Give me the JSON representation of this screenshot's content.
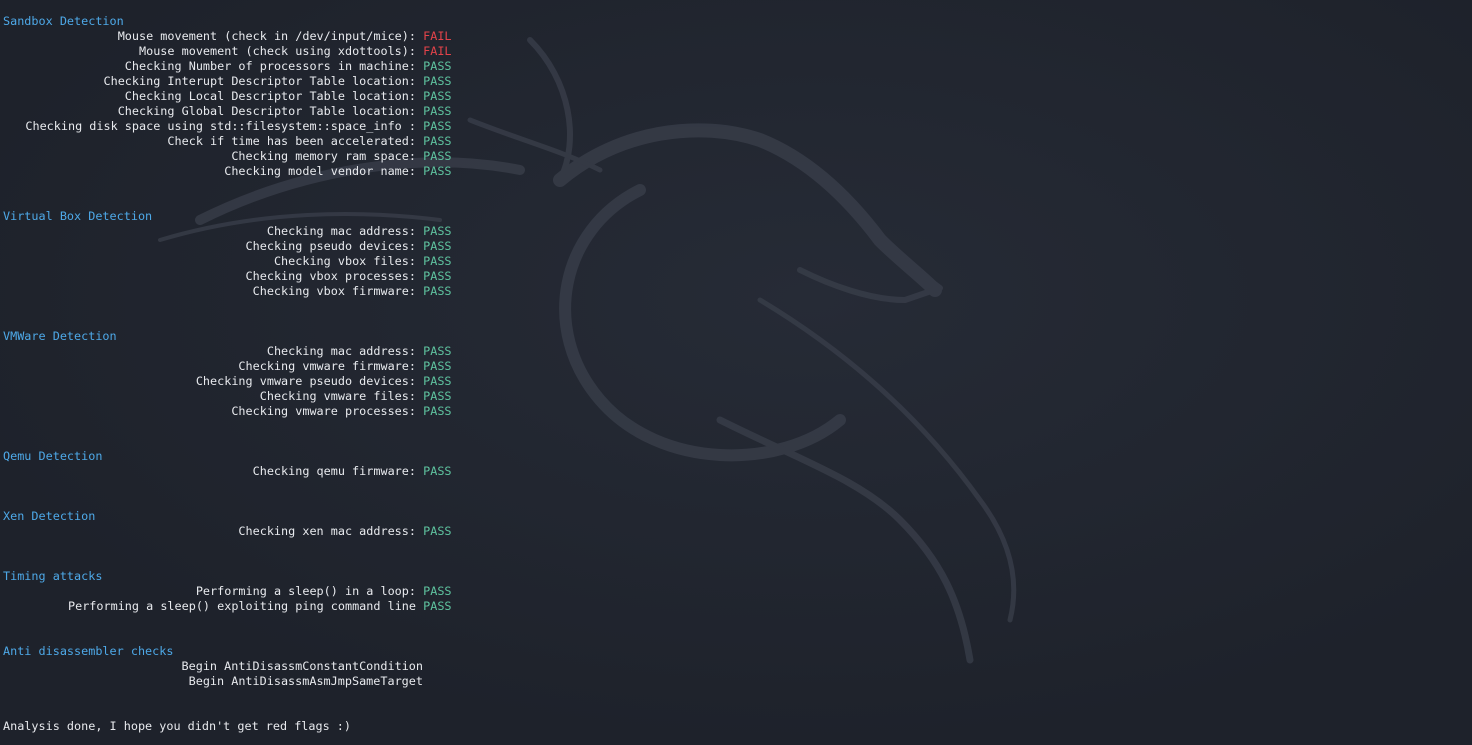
{
  "colors": {
    "background": "#1f232d",
    "header": "#4ea9e8",
    "pass": "#5fc4a0",
    "fail": "#e3434a",
    "text": "#e8eaee"
  },
  "background_icon": "kali-dragon-watermark",
  "sections": [
    {
      "title": "Sandbox Detection",
      "checks": [
        {
          "label": "Mouse movement (check in /dev/input/mice)",
          "sep": ":",
          "status": "FAIL"
        },
        {
          "label": "Mouse movement (check using xdottools)",
          "sep": ":",
          "status": "FAIL"
        },
        {
          "label": "Checking Number of processors in machine",
          "sep": ":",
          "status": "PASS"
        },
        {
          "label": "Checking Interupt Descriptor Table location",
          "sep": ":",
          "status": "PASS"
        },
        {
          "label": "Checking Local Descriptor Table location",
          "sep": ":",
          "status": "PASS"
        },
        {
          "label": "Checking Global Descriptor Table location",
          "sep": ":",
          "status": "PASS"
        },
        {
          "label": "Checking disk space using std::filesystem::space_info ",
          "sep": ":",
          "status": "PASS"
        },
        {
          "label": "Check if time has been accelerated",
          "sep": ":",
          "status": "PASS"
        },
        {
          "label": "Checking memory ram space",
          "sep": ":",
          "status": "PASS"
        },
        {
          "label": "Checking model vendor name",
          "sep": ":",
          "status": "PASS"
        }
      ]
    },
    {
      "title": "Virtual Box Detection",
      "checks": [
        {
          "label": "Checking mac address",
          "sep": ":",
          "status": "PASS"
        },
        {
          "label": "Checking pseudo devices",
          "sep": ":",
          "status": "PASS"
        },
        {
          "label": "Checking vbox files",
          "sep": ":",
          "status": "PASS"
        },
        {
          "label": "Checking vbox processes",
          "sep": ":",
          "status": "PASS"
        },
        {
          "label": "Checking vbox firmware",
          "sep": ":",
          "status": "PASS"
        }
      ]
    },
    {
      "title": "VMWare Detection",
      "checks": [
        {
          "label": "Checking mac address",
          "sep": ":",
          "status": "PASS"
        },
        {
          "label": "Checking vmware firmware",
          "sep": ":",
          "status": "PASS"
        },
        {
          "label": "Checking vmware pseudo devices",
          "sep": ":",
          "status": "PASS"
        },
        {
          "label": "Checking vmware files",
          "sep": ":",
          "status": "PASS"
        },
        {
          "label": "Checking vmware processes",
          "sep": ":",
          "status": "PASS"
        }
      ]
    },
    {
      "title": "Qemu Detection",
      "checks": [
        {
          "label": "Checking qemu firmware",
          "sep": ":",
          "status": "PASS"
        }
      ]
    },
    {
      "title": "Xen Detection",
      "checks": [
        {
          "label": "Checking xen mac address",
          "sep": ":",
          "status": "PASS"
        }
      ]
    },
    {
      "title": "Timing attacks",
      "checks": [
        {
          "label": "Performing a sleep() in a loop",
          "sep": ":",
          "status": "PASS"
        },
        {
          "label": "Performing a sleep() exploiting ping command line",
          "sep": "",
          "status": "PASS"
        }
      ]
    }
  ],
  "anti_disassembler": {
    "title": "Anti disassembler checks",
    "lines": [
      "Begin AntiDisassmConstantCondition",
      "Begin AntiDisassmAsmJmpSameTarget"
    ]
  },
  "footer": "Analysis done, I hope you didn't get red flags :)"
}
